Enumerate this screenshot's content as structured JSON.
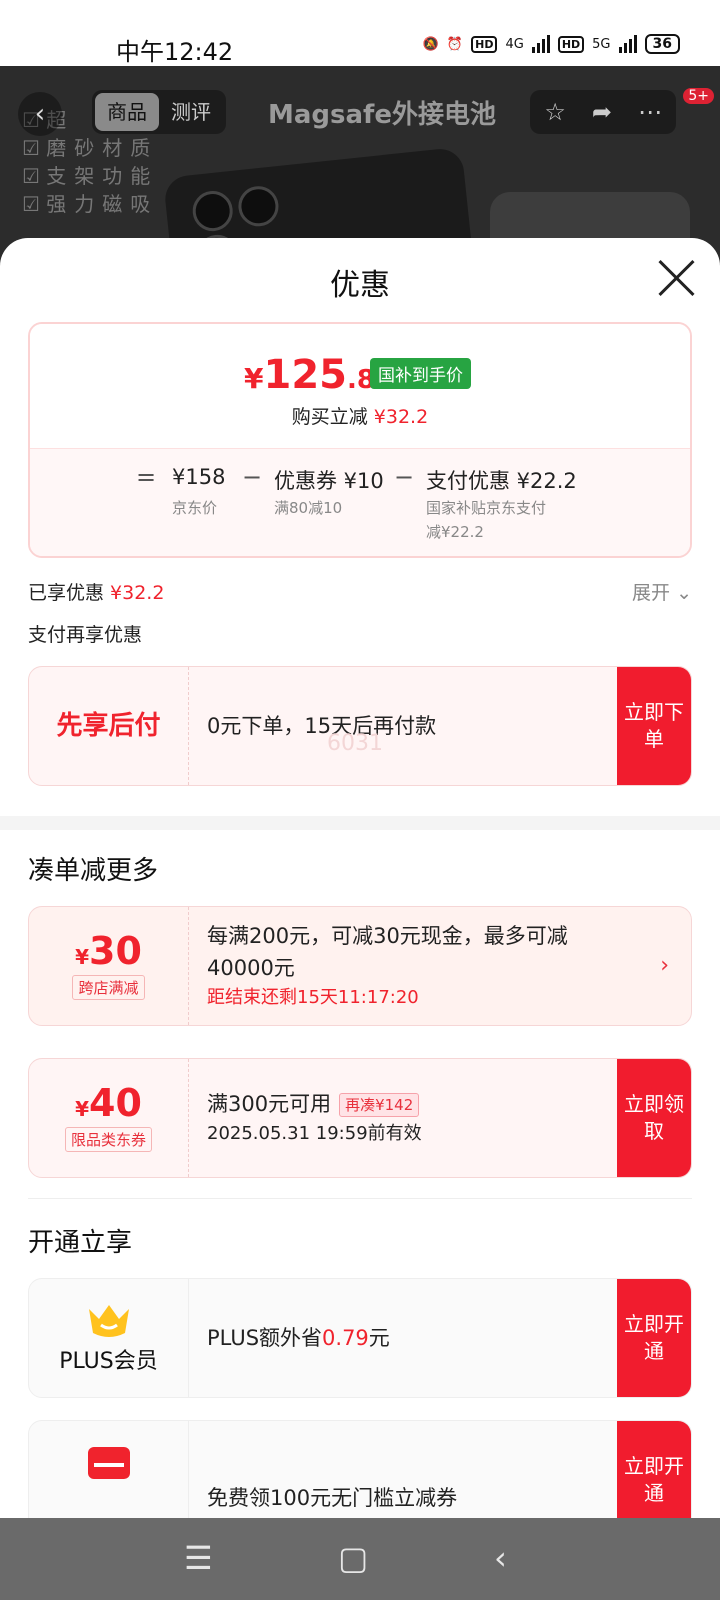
{
  "status": {
    "time": "中午12:42",
    "net1": "4G",
    "net2": "5G",
    "battery": "36"
  },
  "product_bg": {
    "title": "Magsafe外接电池",
    "features": [
      "超",
      "磨砂材质",
      "支架功能",
      "强力磁吸"
    ],
    "tabs": [
      "商品",
      "测评"
    ],
    "badge": "5+"
  },
  "sheet": {
    "title": "优惠",
    "price": {
      "currency": "¥",
      "integer": "125",
      "decimal": ".8",
      "tag": "国补到手价",
      "save_label": "购买立减",
      "save_amount": "¥32.2"
    },
    "formula": {
      "eq": "=",
      "jd_price": "¥158",
      "jd_label": "京东价",
      "minus": "−",
      "coupon": "优惠券 ¥10",
      "coupon_sub": "满80减10",
      "pay": "支付优惠 ¥22.2",
      "pay_sub1": "国家补贴京东支付",
      "pay_sub2": "减¥22.2"
    },
    "enjoyed_label": "已享优惠",
    "enjoyed_amount": "¥32.2",
    "expand": "展开",
    "pay_extra": "支付再享优惠",
    "bnpl": {
      "left": "先享后付",
      "text": "0元下单，15天后再付款",
      "watermark": "6031",
      "action": "立即下单"
    },
    "more_title": "凑单减更多",
    "promo1": {
      "currency": "¥",
      "value": "30",
      "tag": "跨店满减",
      "line1": "每满200元，可减30元现金，最多可减",
      "line2": "40000元",
      "countdown": "距结束还剩15天11:17:20"
    },
    "promo2": {
      "currency": "¥",
      "value": "40",
      "tag": "限品类东券",
      "line1": "满300元可用",
      "re_tag": "再凑¥142",
      "line2": "2025.05.31 19:59前有效",
      "action": "立即领取"
    },
    "open_title": "开通立享",
    "plus": {
      "label": "PLUS会员",
      "text_pre": "PLUS额外省",
      "text_amt": "0.79",
      "text_post": "元",
      "action": "立即开通"
    },
    "coupon100": {
      "text": "免费领100元无门槛立减券",
      "action": "立即开通"
    }
  },
  "colors": {
    "accent_red": "#f0232d",
    "green_tag": "#27a442"
  }
}
